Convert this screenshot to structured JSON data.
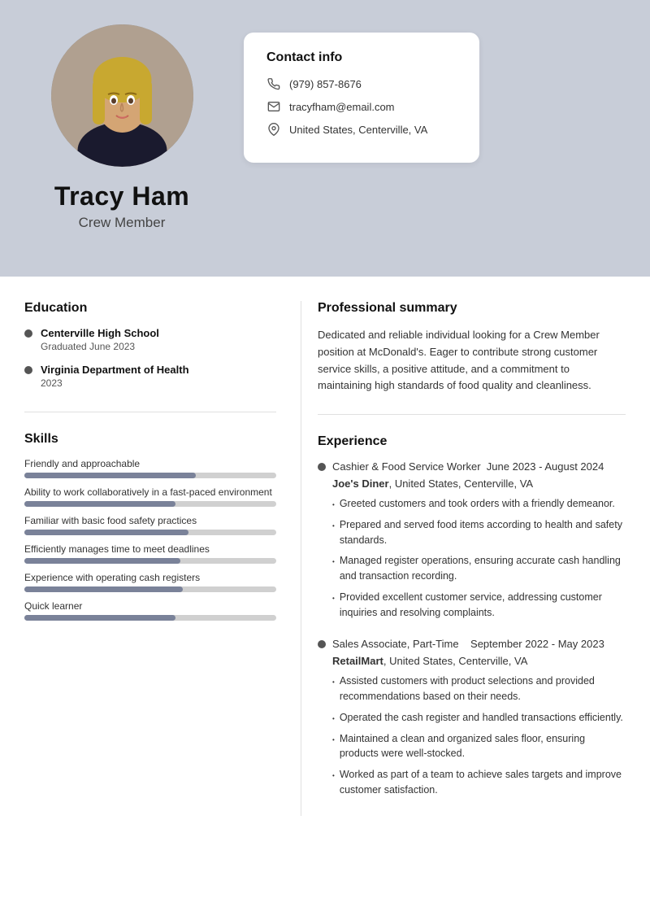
{
  "header": {
    "name": "Tracy Ham",
    "title": "Crew Member",
    "contact": {
      "heading": "Contact info",
      "phone": "(979) 857-8676",
      "email": "tracyfham@email.com",
      "location": "United States, Centerville, VA"
    }
  },
  "education": {
    "section_title": "Education",
    "items": [
      {
        "school": "Centerville High School",
        "detail": "Graduated June 2023"
      },
      {
        "school": "Virginia Department of Health",
        "detail": "2023"
      }
    ]
  },
  "skills": {
    "section_title": "Skills",
    "items": [
      {
        "label": "Friendly and approachable",
        "pct": 68
      },
      {
        "label": "Ability to work collaboratively in a fast-paced environment",
        "pct": 60
      },
      {
        "label": "Familiar with basic food safety practices",
        "pct": 65
      },
      {
        "label": "Efficiently manages time to meet deadlines",
        "pct": 62
      },
      {
        "label": "Experience with operating cash registers",
        "pct": 63
      },
      {
        "label": "Quick learner",
        "pct": 60
      }
    ]
  },
  "summary": {
    "section_title": "Professional summary",
    "text": "Dedicated and reliable individual looking for a Crew Member position at McDonald's. Eager to contribute strong customer service skills, a positive attitude, and a commitment to maintaining high standards of food quality and cleanliness."
  },
  "experience": {
    "section_title": "Experience",
    "jobs": [
      {
        "title": "Cashier & Food Service Worker",
        "dates": "June 2023 - August 2024",
        "company": "Joe's Diner",
        "location": "United States, Centerville, VA",
        "bullets": [
          "Greeted customers and took orders with a friendly demeanor.",
          "Prepared and served food items according to health and safety standards.",
          "Managed register operations, ensuring accurate cash handling and transaction recording.",
          "Provided excellent customer service, addressing customer inquiries and resolving complaints."
        ]
      },
      {
        "title": "Sales Associate, Part-Time",
        "dates": "September 2022 - May 2023",
        "company": "RetailMart",
        "location": "United States, Centerville, VA",
        "bullets": [
          "Assisted customers with product selections and provided recommendations based on their needs.",
          "Operated the cash register and handled transactions efficiently.",
          "Maintained a clean and organized sales floor, ensuring products were well-stocked.",
          "Worked as part of a team to achieve sales targets and improve customer satisfaction."
        ]
      }
    ]
  }
}
